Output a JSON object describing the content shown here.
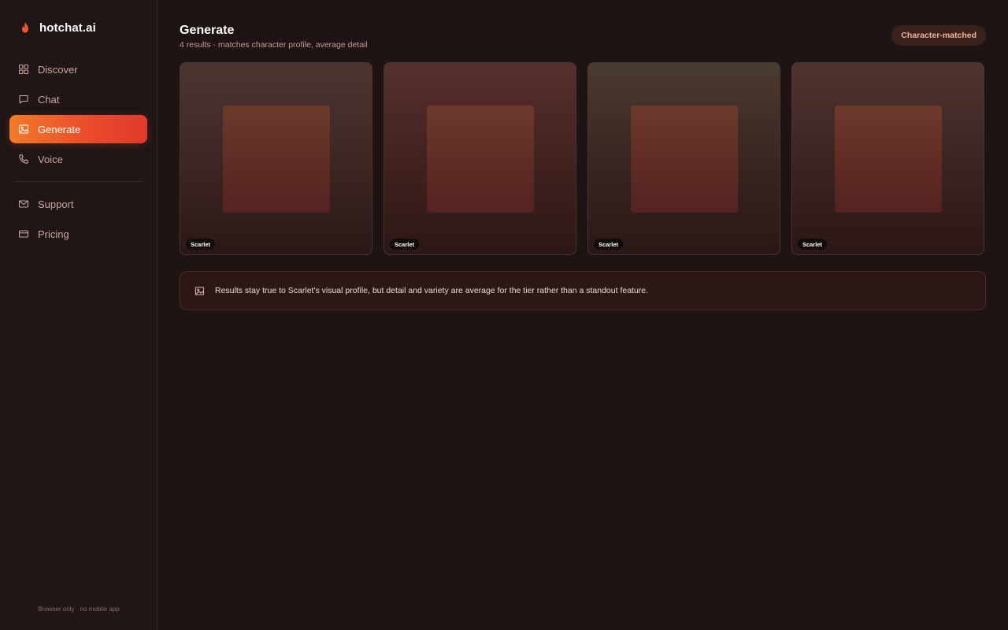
{
  "brand": {
    "name": "hotchat.ai",
    "icon": "flame-icon",
    "accent": "#f0572c"
  },
  "sidebar": {
    "primary": [
      {
        "label": "Discover",
        "icon": "grid-icon",
        "active": false
      },
      {
        "label": "Chat",
        "icon": "chat-bubble-icon",
        "active": false
      },
      {
        "label": "Generate",
        "icon": "image-icon",
        "active": true
      },
      {
        "label": "Voice",
        "icon": "phone-icon",
        "active": false
      }
    ],
    "secondary": [
      {
        "label": "Support",
        "icon": "mail-icon",
        "active": false
      },
      {
        "label": "Pricing",
        "icon": "credit-card-icon",
        "active": false
      }
    ],
    "footer_note": "Browser only · no mobile app"
  },
  "main": {
    "title": "Generate",
    "subtitle": "4 results · matches character profile, average detail",
    "badge": "Character-matched",
    "results": [
      {
        "tag": "Scarlet"
      },
      {
        "tag": "Scarlet"
      },
      {
        "tag": "Scarlet"
      },
      {
        "tag": "Scarlet"
      }
    ],
    "note": {
      "icon": "image-icon",
      "text": "Results stay true to Scarlet's visual profile, but detail and variety are average for the tier rather than a standout feature."
    }
  }
}
